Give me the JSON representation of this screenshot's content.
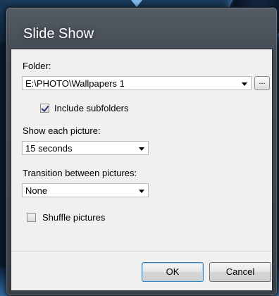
{
  "dialog": {
    "title": "Slide Show"
  },
  "folder": {
    "label": "Folder:",
    "path": "E:\\PHOTO\\Wallpapers 1",
    "browse_label": "..."
  },
  "include_subfolders": {
    "label": "Include subfolders",
    "checked": true
  },
  "show_each": {
    "label": "Show each picture:",
    "value": "15 seconds"
  },
  "transition": {
    "label": "Transition between pictures:",
    "value": "None"
  },
  "shuffle": {
    "label": "Shuffle pictures",
    "checked": false
  },
  "buttons": {
    "ok": "OK",
    "cancel": "Cancel"
  }
}
